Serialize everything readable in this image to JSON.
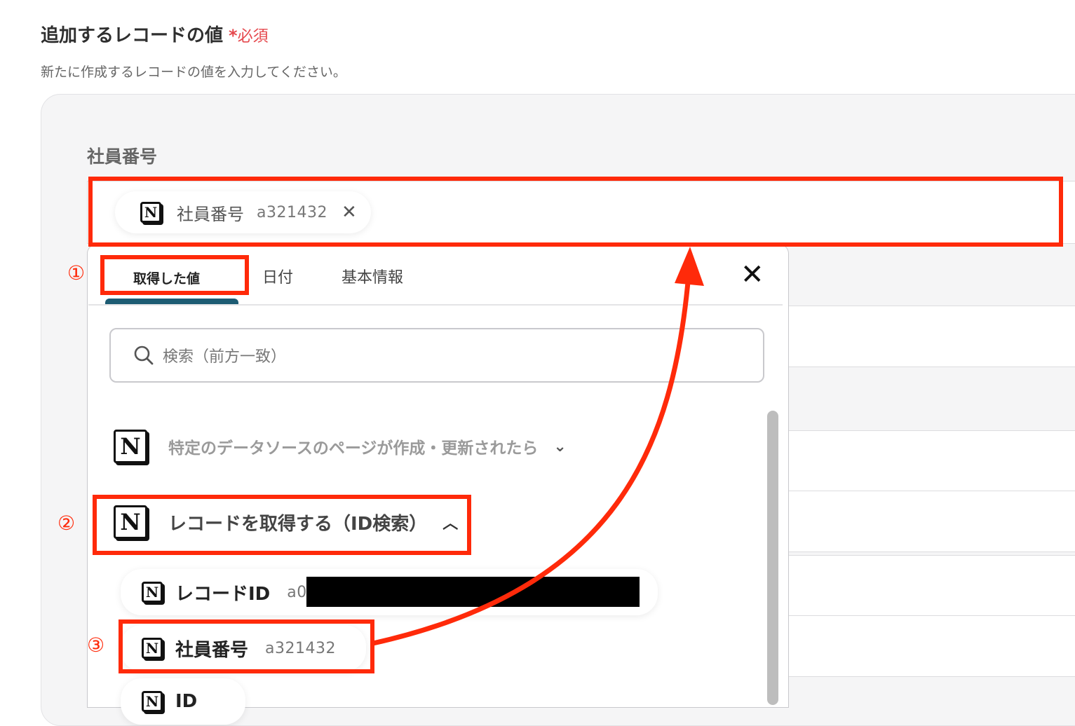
{
  "section": {
    "title": "追加するレコードの値",
    "required_mark": "*",
    "required_label": "必須",
    "description": "新たに作成するレコードの値を入力してください。"
  },
  "field": {
    "label": "社員番号",
    "chip": {
      "label": "社員番号",
      "value": "a321432",
      "icon": "notion-icon",
      "close": "✕"
    }
  },
  "popup": {
    "tabs": [
      {
        "label": "取得した値",
        "active": true
      },
      {
        "label": "日付",
        "active": false
      },
      {
        "label": "基本情報",
        "active": false
      }
    ],
    "close": "✕",
    "search": {
      "placeholder": "検索（前方一致）",
      "icon": "search-icon"
    },
    "groups": [
      {
        "title": "特定のデータソースのページが作成・更新されたら",
        "expanded": false,
        "caret": "⌄",
        "icon": "notion-icon"
      },
      {
        "title": "レコードを取得する（ID検索）",
        "expanded": true,
        "caret": "︿",
        "icon": "notion-icon",
        "items": [
          {
            "label": "レコードID",
            "value": "a0",
            "redacted": true
          },
          {
            "label": "社員番号",
            "value": "a321432"
          },
          {
            "label": "ID",
            "value": ""
          }
        ]
      }
    ]
  },
  "annotations": {
    "step1": "①",
    "step2": "②",
    "step3": "③",
    "color": "#ff2a0a"
  },
  "colors": {
    "accent": "#1d5c73",
    "required": "#e5484d",
    "annotation": "#ff2a0a"
  }
}
